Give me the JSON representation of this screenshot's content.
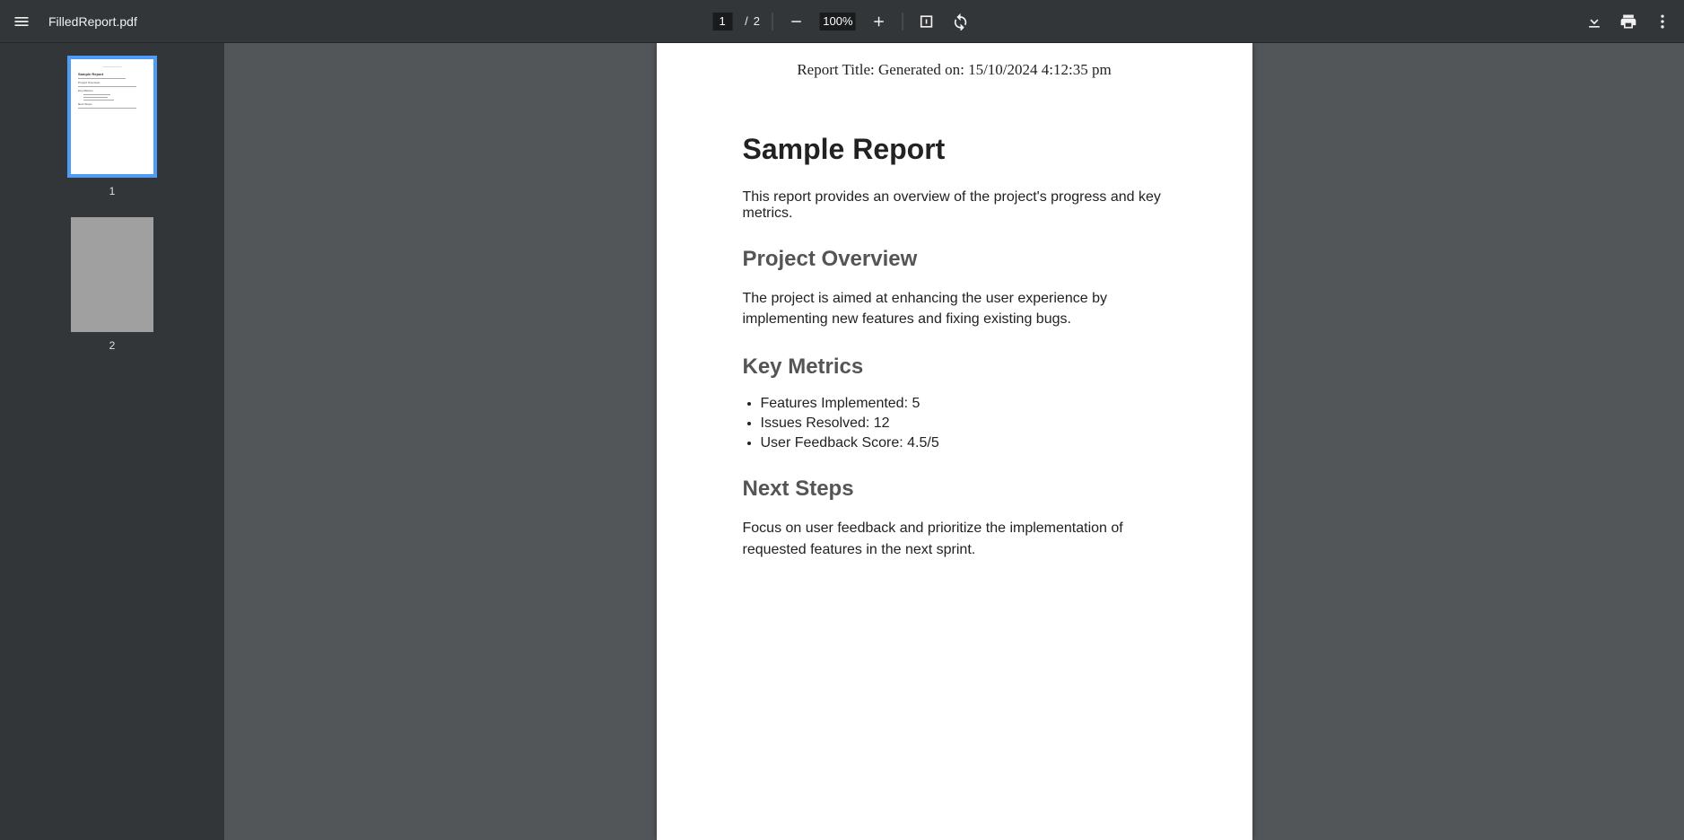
{
  "toolbar": {
    "filename": "FilledReport.pdf",
    "current_page": "1",
    "page_sep": "/",
    "total_pages": "2",
    "zoom": "100%"
  },
  "sidebar": {
    "thumbs": [
      {
        "label": "1"
      },
      {
        "label": "2"
      }
    ]
  },
  "document": {
    "header": "Report Title: Generated on: 15/10/2024 4:12:35 pm",
    "title": "Sample Report",
    "intro": "This report provides an overview of the project's progress and key metrics.",
    "sections": {
      "overview": {
        "heading": "Project Overview",
        "body": "The project is aimed at enhancing the user experience by implementing new features and fixing existing bugs."
      },
      "metrics": {
        "heading": "Key Metrics",
        "items": [
          "Features Implemented: 5",
          "Issues Resolved: 12",
          "User Feedback Score: 4.5/5"
        ]
      },
      "next_steps": {
        "heading": "Next Steps",
        "body": "Focus on user feedback and prioritize the implementation of requested features in the next sprint."
      }
    }
  }
}
